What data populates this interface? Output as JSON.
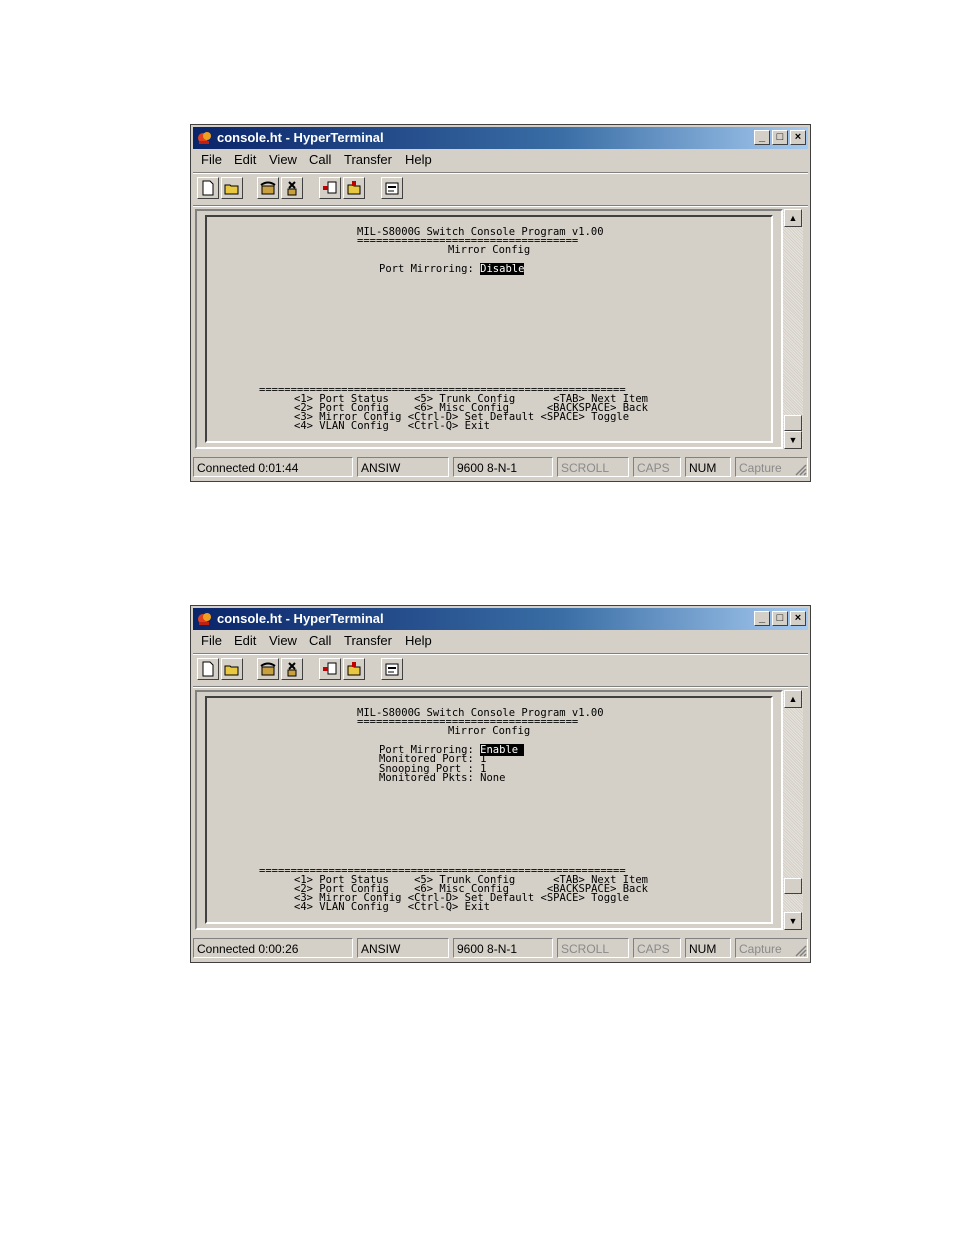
{
  "windows": [
    {
      "title": "console.ht - HyperTerminal",
      "menus": [
        "File",
        "Edit",
        "View",
        "Call",
        "Transfer",
        "Help"
      ],
      "terminal": {
        "header": "MIL-S8000G Switch Console Program v1.00",
        "rule_top": "===================================",
        "subtitle": "Mirror Config",
        "fields": [
          {
            "label": "Port Mirroring: ",
            "value": "Disable",
            "highlight": true
          }
        ],
        "rule_bottom": "==========================================================",
        "footer": [
          "<1> Port Status    <5> Trunk Config      <TAB> Next Item",
          "<2> Port Config    <6> Misc Config      <BACKSPACE> Back",
          "<3> Mirror Config <Ctrl-D> Set Default <SPACE> Toggle",
          "<4> VLAN Config   <Ctrl-Q> Exit"
        ]
      },
      "status": {
        "connected": "Connected 0:01:44",
        "emulation": "ANSIW",
        "settings": "9600 8-N-1",
        "scroll": "SCROLL",
        "caps": "CAPS",
        "num": "NUM",
        "capture": "Capture"
      }
    },
    {
      "title": "console.ht - HyperTerminal",
      "menus": [
        "File",
        "Edit",
        "View",
        "Call",
        "Transfer",
        "Help"
      ],
      "terminal": {
        "header": "MIL-S8000G Switch Console Program v1.00",
        "rule_top": "===================================",
        "subtitle": "Mirror Config",
        "fields": [
          {
            "label": "Port Mirroring: ",
            "value": "Enable ",
            "highlight": true
          },
          {
            "label": "Monitored Port: ",
            "value": "1",
            "highlight": false
          },
          {
            "label": "Snooping Port : ",
            "value": "1",
            "highlight": false
          },
          {
            "label": "Monitored Pkts: ",
            "value": "None",
            "highlight": false
          }
        ],
        "rule_bottom": "==========================================================",
        "footer": [
          "<1> Port Status    <5> Trunk Config      <TAB> Next Item",
          "<2> Port Config    <6> Misc Config      <BACKSPACE> Back",
          "<3> Mirror Config <Ctrl-D> Set Default <SPACE> Toggle",
          "<4> VLAN Config   <Ctrl-Q> Exit"
        ]
      },
      "status": {
        "connected": "Connected 0:00:26",
        "emulation": "ANSIW",
        "settings": "9600 8-N-1",
        "scroll": "SCROLL",
        "caps": "CAPS",
        "num": "NUM",
        "capture": "Capture"
      }
    }
  ]
}
